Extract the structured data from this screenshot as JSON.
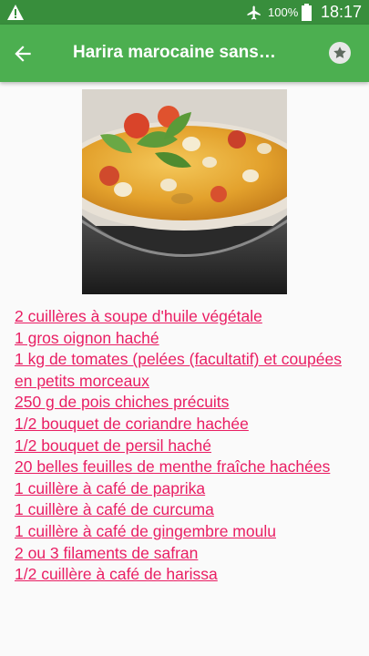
{
  "statusbar": {
    "battery_text": "100%",
    "time": "18:17",
    "icons": [
      "warning-icon",
      "airplane-mode-icon",
      "battery-full-icon"
    ]
  },
  "appbar": {
    "title": "Harira marocaine sans…",
    "icons": [
      "back-arrow-icon",
      "favorite-star-icon"
    ]
  },
  "ingredients": [
    "2 cuillères à soupe d'huile végétale",
    "1 gros oignon haché",
    "1 kg de tomates (pelées (facultatif) et coupées en petits morceaux",
    "250 g de pois chiches précuits",
    "1/2 bouquet de coriandre hachée",
    "1/2 bouquet de persil haché",
    "20 belles feuilles de menthe fraîche hachées",
    "1 cuillère à café de paprika",
    "1 cuillère à café de curcuma",
    "1 cuillère à café de gingembre moulu",
    "2 ou 3 filaments de safran",
    "1/2 cuillère à café de harissa"
  ],
  "colors": {
    "statusbar": "#388e3c",
    "appbar": "#4caf50",
    "link": "#e91e63",
    "background": "#fafafa"
  }
}
